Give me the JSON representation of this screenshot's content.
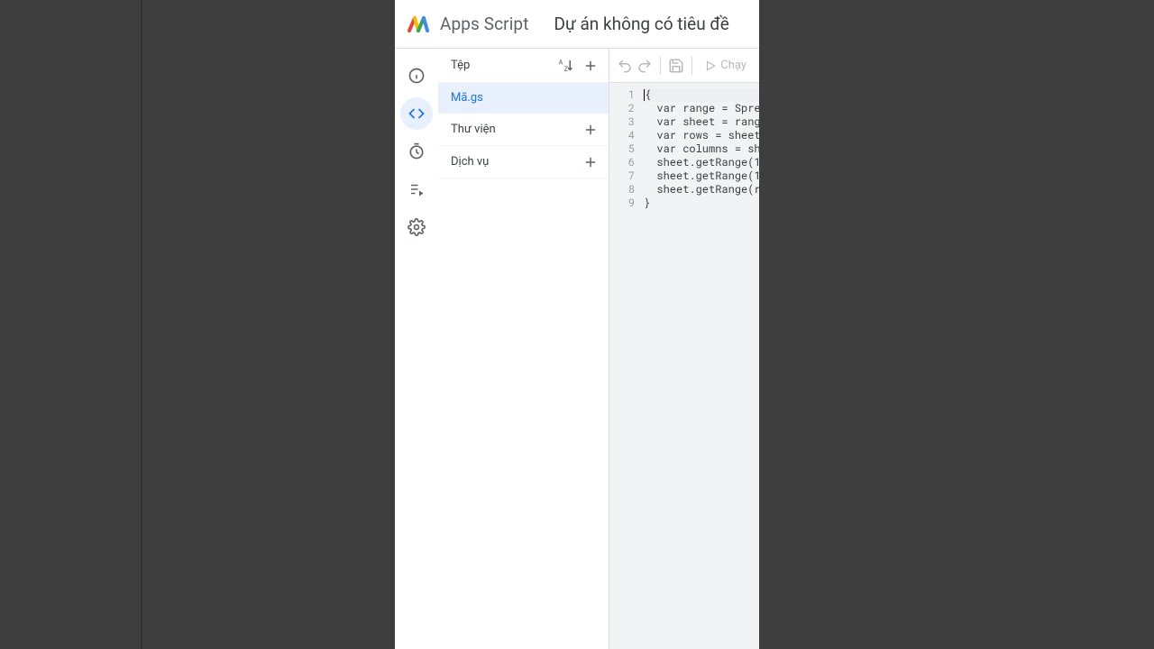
{
  "header": {
    "product": "Apps Script",
    "project_title": "Dự án không có tiêu đề"
  },
  "rail": {
    "items": [
      {
        "name": "overview-icon"
      },
      {
        "name": "editor-icon"
      },
      {
        "name": "triggers-icon"
      },
      {
        "name": "executions-icon"
      },
      {
        "name": "settings-icon"
      }
    ],
    "active_index": 1
  },
  "panel": {
    "sections": {
      "files": {
        "label": "Tệp"
      },
      "libraries": {
        "label": "Thư viện"
      },
      "services": {
        "label": "Dịch vụ"
      }
    },
    "files": [
      {
        "name": "Mã.gs"
      }
    ]
  },
  "toolbar": {
    "run_label": "Chạy"
  },
  "editor": {
    "lines": [
      "{",
      "  var range = Spre",
      "  var sheet = rang",
      "  var rows = sheet",
      "  var columns = sh",
      "  sheet.getRange(1",
      "  sheet.getRange(1",
      "  sheet.getRange(r",
      "}"
    ]
  }
}
